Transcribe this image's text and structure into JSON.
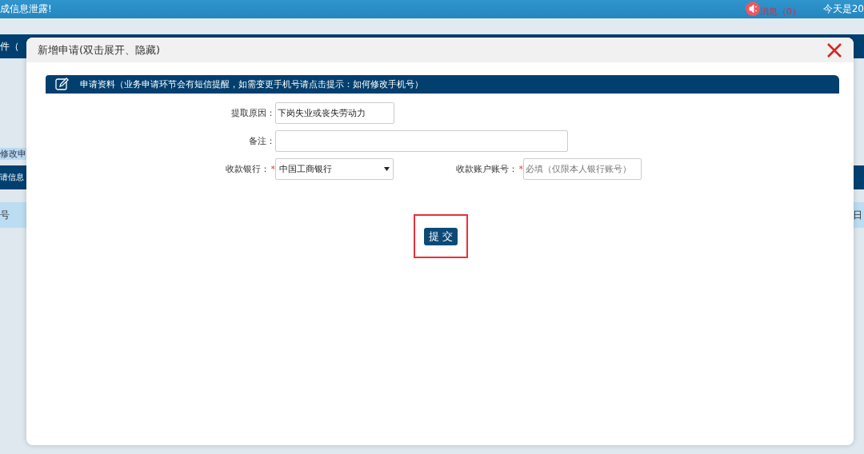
{
  "top_bar": {
    "notice": "成信息泄露!",
    "messages": "消息（0）",
    "date": "今天是20"
  },
  "nav_bar": {
    "title": "件（"
  },
  "background": {
    "link": "修改申",
    "section": "请信息",
    "columns": [
      "号",
      "日"
    ]
  },
  "dialog": {
    "title": "新增申请(双击展开、隐藏)",
    "section": "申请资料（业务申请环节会有短信提醒，如需变更手机号请点击提示：如何修改手机号）",
    "rows": [
      [
        {
          "kind": "text",
          "label": "提取原因：",
          "value": "下岗失业或丧失劳动力",
          "wide": false
        }
      ],
      [
        {
          "kind": "text",
          "label": "备注：",
          "wide": true
        }
      ],
      [
        {
          "kind": "select",
          "label": "收款银行：",
          "mark": "*",
          "value": "中国工商银行"
        },
        {
          "kind": "text",
          "label": "收款账户账号：",
          "mark": "*",
          "placeholder": "必填（仅限本人银行账号）",
          "wide": false
        }
      ]
    ],
    "submit": "提交",
    "submit_highlighted": true
  }
}
